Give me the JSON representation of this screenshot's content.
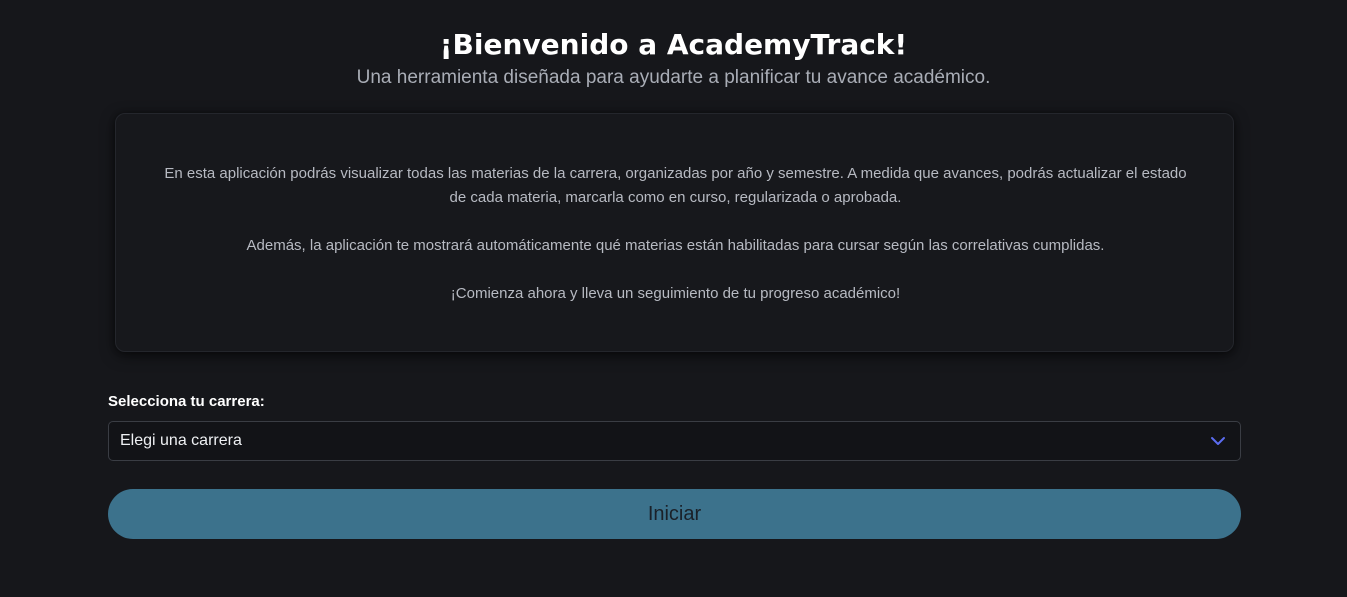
{
  "header": {
    "title": "¡Bienvenido a AcademyTrack!",
    "subtitle": "Una herramienta diseñada para ayudarte a planificar tu avance académico."
  },
  "info_card": {
    "paragraphs": [
      "En esta aplicación podrás visualizar todas las materias de la carrera, organizadas por año y semestre. A medida que avances, podrás actualizar el estado de cada materia, marcarla como en curso, regularizada o aprobada.",
      "Además, la aplicación te mostrará automáticamente qué materias están habilitadas para cursar según las correlativas cumplidas.",
      "¡Comienza ahora y lleva un seguimiento de tu progreso académico!"
    ]
  },
  "career_select": {
    "label": "Selecciona tu carrera:",
    "selected_value": "Elegi una carrera",
    "icon": "chevron-down-icon"
  },
  "start_button": {
    "label": "Iniciar"
  },
  "colors": {
    "background": "#16171b",
    "card_background": "#17181c",
    "accent_button": "#3c728c",
    "chevron": "#5b6cf0"
  }
}
